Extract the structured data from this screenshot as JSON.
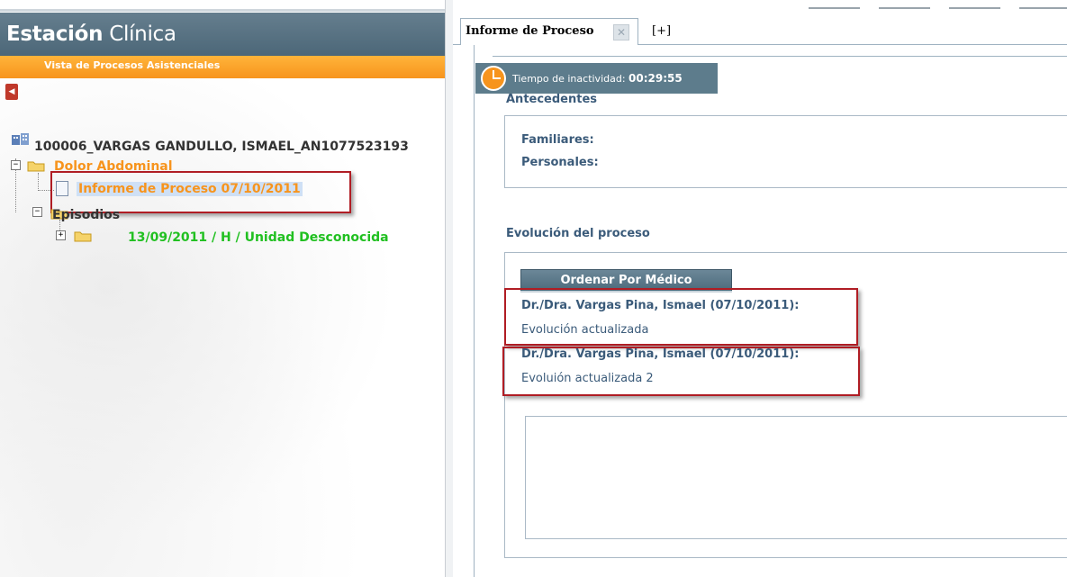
{
  "app": {
    "title_bold": "Estación",
    "title_light": "Clínica",
    "subtitle": "Vista de Procesos Asistenciales"
  },
  "tree": {
    "patient": "100006_VARGAS GANDULLO, ISMAEL_AN1077523193",
    "process": "Dolor Abdominal",
    "report": "Informe de Proceso 07/10/2011",
    "episodes_label": "Episodios",
    "episode": "13/09/2011 / H / Unidad Desconocida",
    "expander_minus": "−",
    "expander_plus": "+"
  },
  "tabs": {
    "active_label": "Informe de Proceso",
    "close_glyph": "✕",
    "add_label": "[+]"
  },
  "inactivity": {
    "label": "Tiempo de inactividad:",
    "value": "00:29:55"
  },
  "antecedentes": {
    "title": "Antecedentes",
    "familiares": "Familiares:",
    "personales": "Personales:"
  },
  "evolucion": {
    "title": "Evolución del proceso",
    "sort_button": "Ordenar Por Médico",
    "entries": [
      {
        "head": "Dr./Dra. Vargas Pina, Ismael (07/10/2011):",
        "text": "Evolución actualizada"
      },
      {
        "head": "Dr./Dra. Vargas Pina, Ismael (07/10/2011):",
        "text": "Evoluión actualizada 2"
      }
    ]
  },
  "colors": {
    "header_blue": "#5d7c8c",
    "orange": "#f7941d",
    "green": "#21c021",
    "highlight_red": "#b01d24",
    "text_blue": "#3b5b7a"
  }
}
